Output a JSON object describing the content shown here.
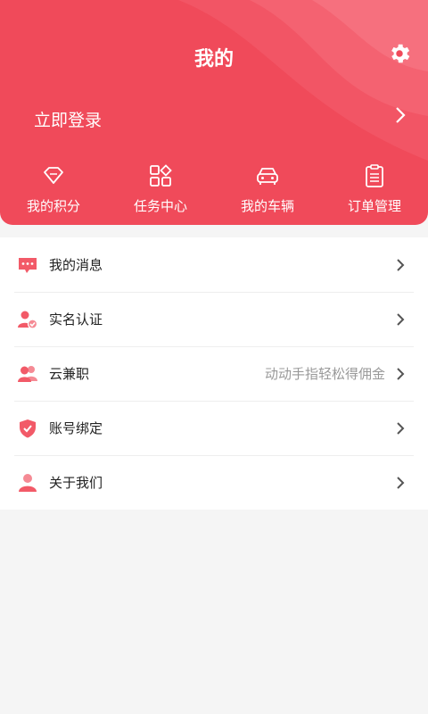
{
  "page_title": "我的",
  "header_color": "#f04a5a",
  "login_label": "立即登录",
  "shortcuts": [
    {
      "label": "我的积分",
      "icon": "diamond-icon"
    },
    {
      "label": "任务中心",
      "icon": "task-grid-icon"
    },
    {
      "label": "我的车辆",
      "icon": "car-icon"
    },
    {
      "label": "订单管理",
      "icon": "clipboard-icon"
    }
  ],
  "menu": [
    {
      "label": "我的消息",
      "icon": "message-icon",
      "extra": ""
    },
    {
      "label": "实名认证",
      "icon": "user-verify-icon",
      "extra": ""
    },
    {
      "label": "云兼职",
      "icon": "group-icon",
      "extra": "动动手指轻松得佣金"
    },
    {
      "label": "账号绑定",
      "icon": "shield-check-icon",
      "extra": ""
    },
    {
      "label": "关于我们",
      "icon": "user-icon",
      "extra": ""
    }
  ]
}
